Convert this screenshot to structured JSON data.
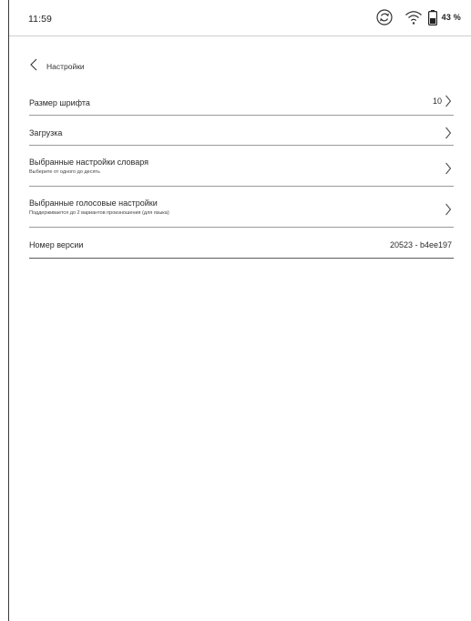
{
  "status_bar": {
    "time": "11:59",
    "battery_percent": "43 %",
    "icons": [
      "sync-icon",
      "wifi-icon",
      "battery-icon"
    ]
  },
  "header": {
    "title": "Настройки",
    "back_icon": "chevron-left-icon"
  },
  "settings": {
    "font_size": {
      "title": "Размер шрифта",
      "value": "10"
    },
    "download": {
      "title": "Загрузка"
    },
    "dictionary": {
      "title": "Выбранные настройки словаря",
      "subtitle": "Выберите от одного до десять"
    },
    "voice": {
      "title": "Выбранные голосовые настройки",
      "subtitle": "Поддерживается до 2 вариантов произношения (для языка)"
    },
    "version": {
      "title": "Номер версии",
      "value": "20523 - b4ee197"
    }
  },
  "colors": {
    "text": "#1e1e1e",
    "divider": "#9a9a9a",
    "background": "#ffffff"
  }
}
